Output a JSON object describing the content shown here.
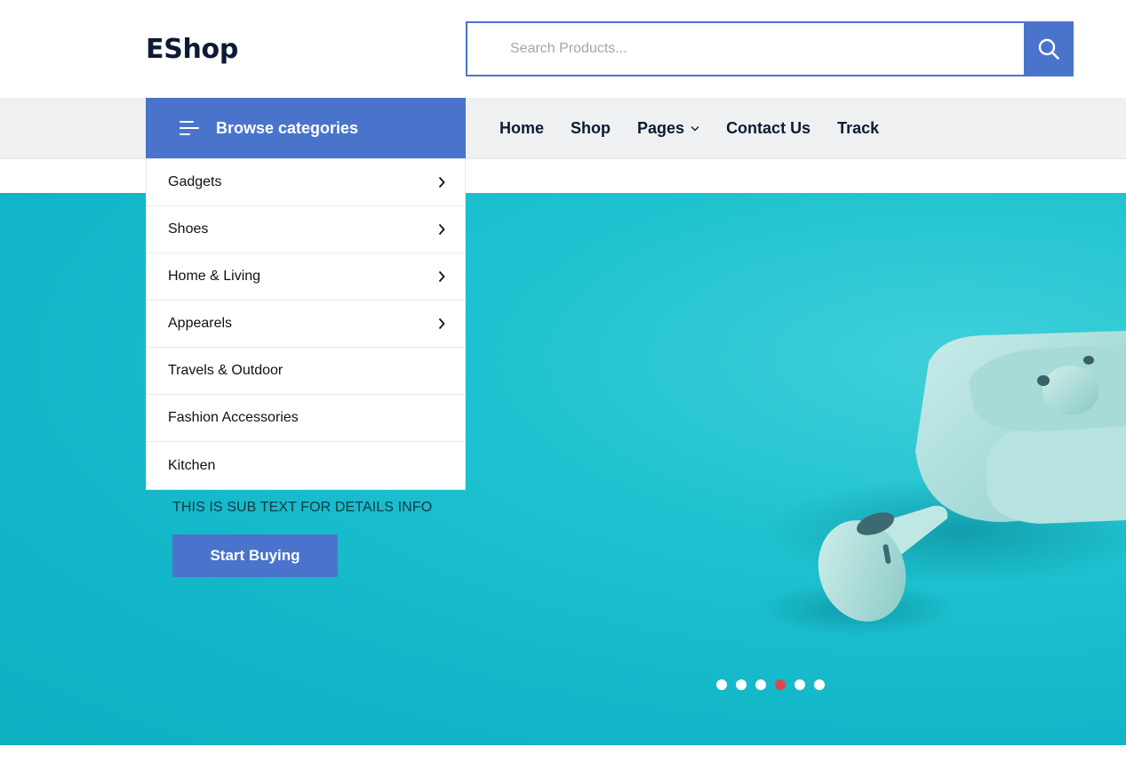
{
  "header": {
    "logo": "EShop",
    "search": {
      "placeholder": "Search Products...",
      "value": ""
    }
  },
  "nav": {
    "browse_label": "Browse categories",
    "links": [
      {
        "label": "Home",
        "has_dropdown": false
      },
      {
        "label": "Shop",
        "has_dropdown": false
      },
      {
        "label": "Pages",
        "has_dropdown": true
      },
      {
        "label": "Contact Us",
        "has_dropdown": false
      },
      {
        "label": "Track",
        "has_dropdown": false
      }
    ]
  },
  "categories": [
    {
      "label": "Gadgets",
      "has_submenu": true
    },
    {
      "label": "Shoes",
      "has_submenu": true
    },
    {
      "label": "Home & Living",
      "has_submenu": true
    },
    {
      "label": "Appearels",
      "has_submenu": true
    },
    {
      "label": "Travels & Outdoor",
      "has_submenu": false
    },
    {
      "label": "Fashion Accessories",
      "has_submenu": false
    },
    {
      "label": "Kitchen",
      "has_submenu": false
    }
  ],
  "hero": {
    "sub_text": "THIS IS SUB TEXT FOR DETAILS INFO",
    "button_label": "Start Buying",
    "slide_count": 6,
    "active_slide": 4
  },
  "colors": {
    "accent": "#4a74cc",
    "hero_bg": "#12b6c8",
    "active_dot": "#e0474c",
    "text_dark": "#0b1b33"
  },
  "icons": {
    "search": "search-icon",
    "menu": "hamburger-icon",
    "chevron_right": "chevron-right-icon",
    "chevron_down": "chevron-down-icon"
  }
}
